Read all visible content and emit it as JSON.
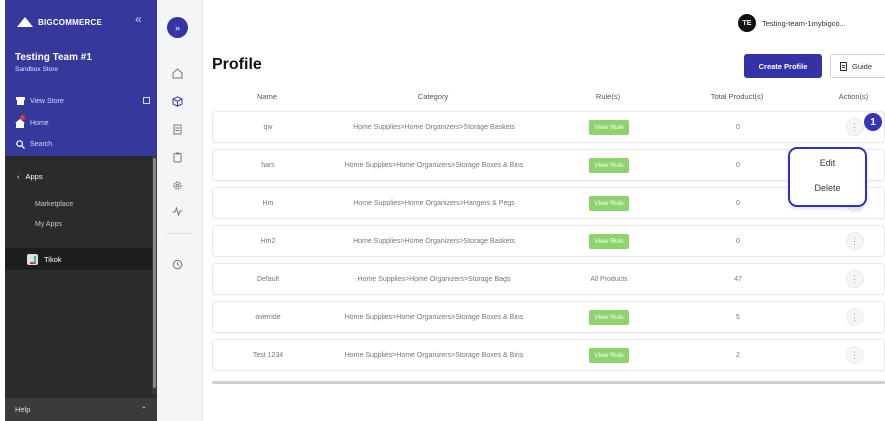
{
  "sidebar": {
    "brand": "BIGCOMMERCE",
    "store_name": "Testing Team #1",
    "store_type": "Sandbox Store",
    "view_store": "View Store",
    "home": "Home",
    "search": "Search",
    "apps": "Apps",
    "marketplace": "Marketplace",
    "my_apps": "My Apps",
    "installed_app": "Tikok",
    "help": "Help"
  },
  "header": {
    "avatar_initials": "TE",
    "account_name": "Testing-team-1mybigco..."
  },
  "page": {
    "title": "Profile",
    "create_button": "Create Profile",
    "guide_button": "Guide"
  },
  "table": {
    "headers": [
      "Name",
      "Category",
      "Rule(s)",
      "Total Product(s)",
      "Action(s)"
    ],
    "rows": [
      {
        "name": "qw",
        "category": "Home Supplies>Home Organizers>Storage Baskets",
        "rule": "View Rule",
        "total": "0"
      },
      {
        "name": "hars",
        "category": "Home Supplies>Home Organizers>Storage Boxes & Bins",
        "rule": "View Rule",
        "total": "0"
      },
      {
        "name": "Hm",
        "category": "Home Supplies>Home Organizers>Hangers & Pegs",
        "rule": "View Rule",
        "total": "0"
      },
      {
        "name": "Hm2",
        "category": "Home Supplies>Home Organizers>Storage Baskets",
        "rule": "View Rule",
        "total": "0"
      },
      {
        "name": "Default",
        "category": "Home Supplies>Home Organizers>Storage Bags",
        "rule": "All Products",
        "total": "47"
      },
      {
        "name": "override",
        "category": "Home Supplies>Home Organizers>Storage Boxes & Bins",
        "rule": "View Rule",
        "total": "5"
      },
      {
        "name": "Test 1234",
        "category": "Home Supplies>Home Organizers>Storage Boxes & Bins",
        "rule": "View Rule",
        "total": "2"
      }
    ]
  },
  "popover": {
    "step": "1",
    "edit": "Edit",
    "delete": "Delete"
  },
  "colors": {
    "brand": "#34399b",
    "accent": "#3333a5",
    "rule_badge": "#8fd36d",
    "highlight": "#2e30c7"
  },
  "icons": [
    "chevron-left-double-icon",
    "chevron-right-double-icon",
    "store-icon",
    "home-icon",
    "search-icon",
    "home-rail-icon",
    "box-icon",
    "document-icon",
    "clipboard-icon",
    "gear-icon",
    "activity-icon",
    "clock-icon",
    "guide-doc-icon",
    "kebab-icon"
  ]
}
